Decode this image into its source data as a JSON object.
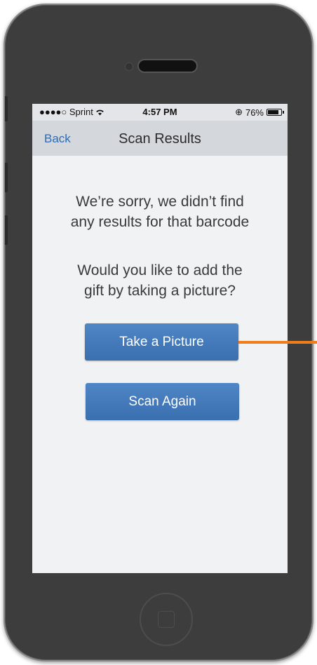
{
  "status_bar": {
    "carrier": "●●●●○ Sprint",
    "wifi_icon": "wifi-icon",
    "time": "4:57 PM",
    "rotation_lock_icon": "⊕",
    "battery": "76%",
    "battery_level": 0.76
  },
  "nav": {
    "back_label": "Back",
    "title": "Scan Results"
  },
  "content": {
    "message_line1": "We’re sorry, we didn’t find",
    "message_line2": "any results for that barcode",
    "question_line1": "Would you like to add the",
    "question_line2": "gift by taking a picture?"
  },
  "buttons": {
    "take_picture": "Take a Picture",
    "scan_again": "Scan Again"
  },
  "colors": {
    "accent": "#2d6cb3",
    "button": "#4479bb",
    "callout": "#f07d1a"
  }
}
